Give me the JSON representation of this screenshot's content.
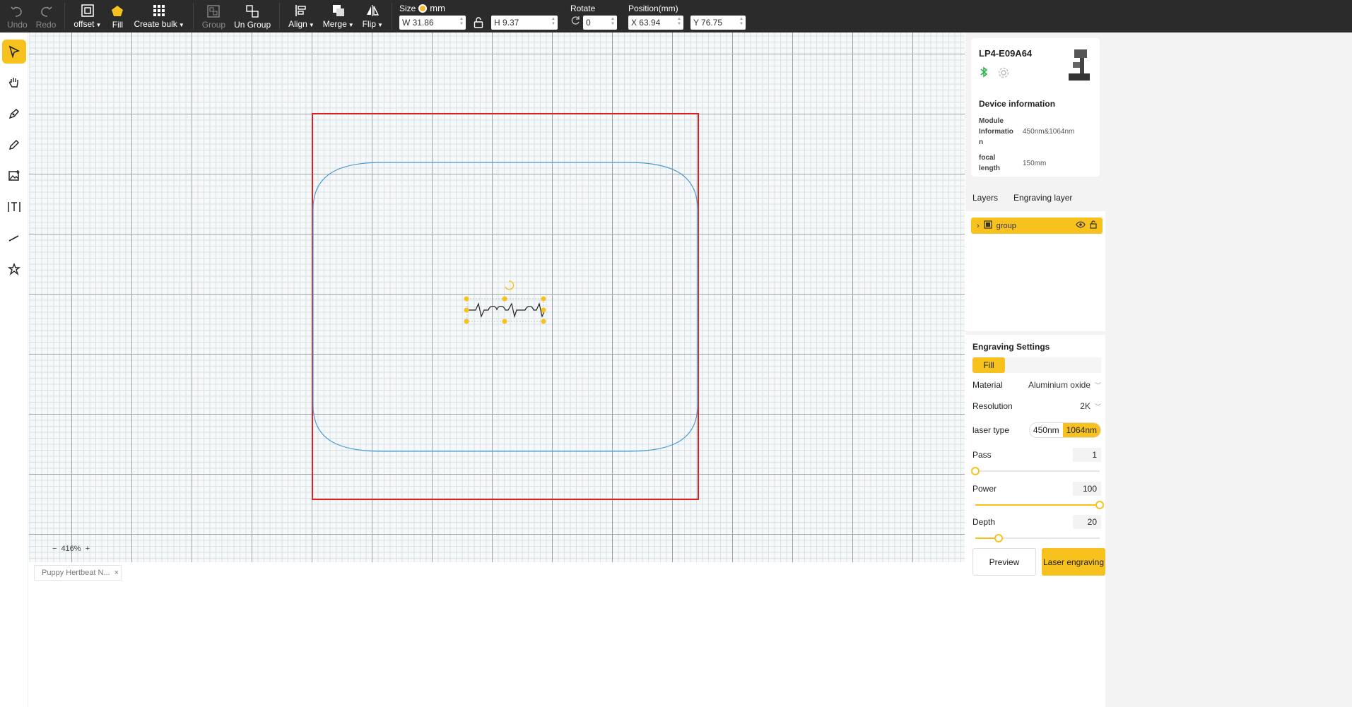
{
  "toolbar": {
    "undo": "Undo",
    "redo": "Redo",
    "offset": "offset",
    "fill": "Fill",
    "create_bulk": "Create bulk",
    "group": "Group",
    "ungroup": "Un Group",
    "align": "Align",
    "merge": "Merge",
    "flip": "Flip",
    "size_label": "Size",
    "unit": "mm",
    "width_value": "W 31.86",
    "height_value": "H 9.37",
    "rotate_label": "Rotate",
    "rotate_value": "0",
    "position_label": "Position(mm)",
    "x_value": "X 63.94",
    "y_value": "Y 76.75"
  },
  "tools": [
    "select-tool",
    "hand-tool",
    "pen-tool",
    "pencil-tool",
    "image-tool",
    "text-tool",
    "line-tool",
    "shape-tool"
  ],
  "canvas": {
    "zoom": "416%",
    "zoom_minus": "−",
    "zoom_plus": "+",
    "file_tab": "Puppy Hertbeat N...",
    "close_glyph": "×"
  },
  "device": {
    "name": "LP4-E09A64",
    "info_title": "Device information",
    "module_label": "Module Informatio n",
    "module_value": "450nm&1064nm",
    "focal_label": "focal length",
    "focal_value": "150mm"
  },
  "layers": {
    "tab_layers": "Layers",
    "tab_engraving": "Engraving layer",
    "item_name": "group"
  },
  "settings": {
    "title": "Engraving Settings",
    "mode": "Fill",
    "material_label": "Material",
    "material_value": "Aluminium oxide",
    "resolution_label": "Resolution",
    "resolution_value": "2K",
    "laser_type_label": "laser type",
    "laser_options": [
      "450nm",
      "1064nm"
    ],
    "laser_selected": "1064nm",
    "pass_label": "Pass",
    "pass_value": "1",
    "pass_level": 0,
    "power_label": "Power",
    "power_value": "100",
    "power_level": 1.0,
    "depth_label": "Depth",
    "depth_value": "20",
    "depth_level": 0.19,
    "preview_button": "Preview",
    "laser_button": "Laser engraving"
  },
  "colors": {
    "accent": "#f7c21e",
    "toolbar_bg": "#2b2b2b",
    "work_area": "#e02020",
    "outline": "#4a9ad4"
  }
}
